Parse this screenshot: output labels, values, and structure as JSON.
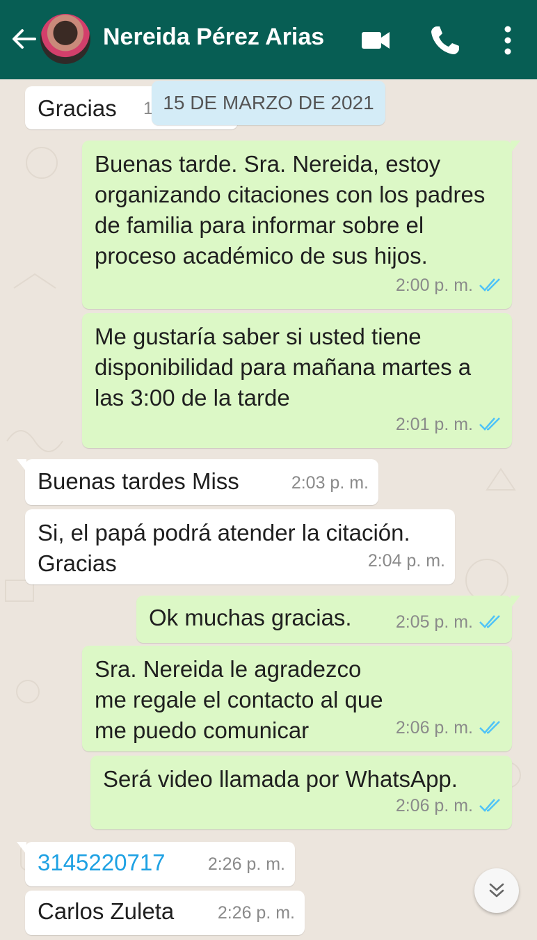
{
  "header": {
    "contact_name": "Nereida Pérez Arias",
    "background": "#075e54",
    "icons": [
      "back-arrow-icon",
      "video-call-icon",
      "phone-icon",
      "more-vert-icon"
    ]
  },
  "date_chip": "15 DE MARZO DE 2021",
  "messages": [
    {
      "dir": "in",
      "text": "Gracias",
      "time": "1"
    },
    {
      "dir": "out",
      "text": "Buenas tarde. Sra. Nereida, estoy organizando citaciones con los padres de familia para informar sobre el proceso académico de sus hijos.",
      "time": "2:00 p. m."
    },
    {
      "dir": "out",
      "text": "Me gustaría saber si usted tiene disponibilidad para mañana martes a las 3:00 de la tarde",
      "time": "2:01 p. m."
    },
    {
      "dir": "in",
      "text": "Buenas tardes Miss",
      "time": "2:03 p. m."
    },
    {
      "dir": "in",
      "text": "Si, el papá podrá atender la citación. Gracias",
      "time": "2:04 p. m."
    },
    {
      "dir": "out",
      "text": "Ok muchas gracias.",
      "time": "2:05 p. m."
    },
    {
      "dir": "out",
      "text": "Sra. Nereida le agradezco me regale el contacto al que me puedo comunicar",
      "time": "2:06 p. m."
    },
    {
      "dir": "out",
      "text": "Será video llamada por WhatsApp.",
      "time": "2:06 p. m."
    },
    {
      "dir": "in",
      "text": "3145220717",
      "time": "2:26 p. m."
    },
    {
      "dir": "in",
      "text": "Carlos Zuleta",
      "time": "2:26 p. m."
    }
  ],
  "colors": {
    "incoming_bubble": "#ffffff",
    "outgoing_bubble": "#dcf8c6",
    "read_ticks": "#4fc3f7",
    "link": "#1ea1e3",
    "chat_background": "#ece5dd"
  }
}
